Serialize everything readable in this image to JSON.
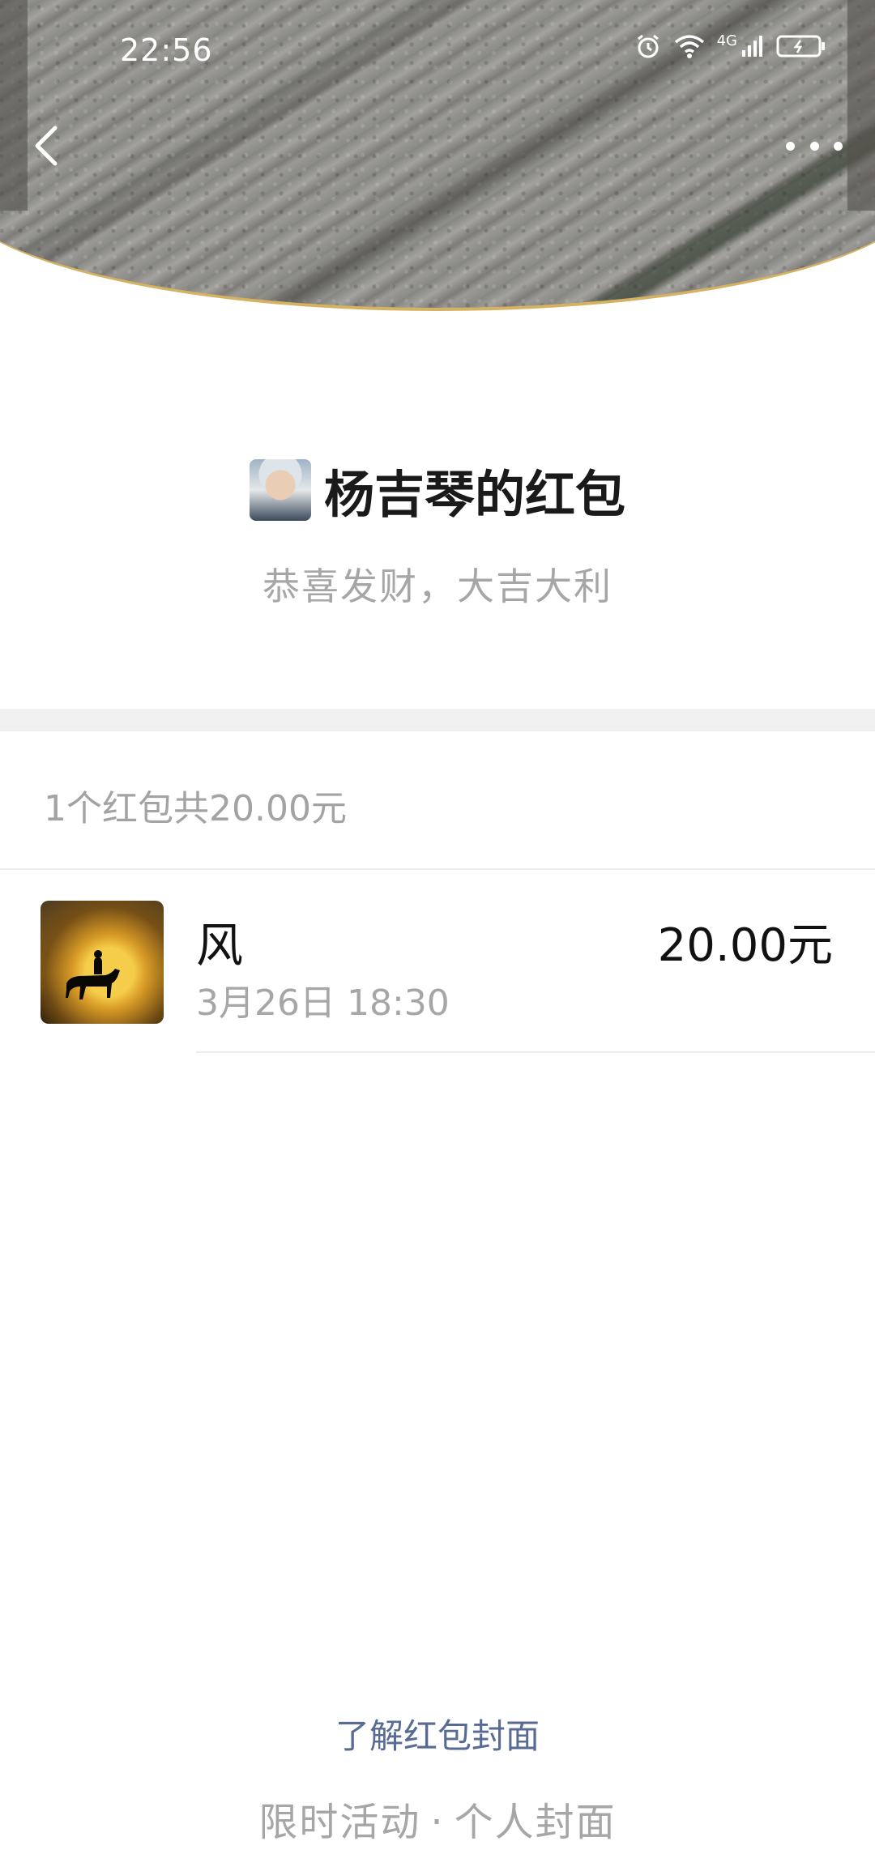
{
  "status_bar": {
    "time": "22:56",
    "network": "4G"
  },
  "nav": {
    "back_icon": "chevron-left-icon",
    "more_icon": "more-dots-icon"
  },
  "sender": {
    "title": "杨吉琴的红包",
    "wish": "恭喜发财，大吉大利"
  },
  "summary": {
    "text": "1个红包共20.00元"
  },
  "receivers": [
    {
      "name": "风",
      "time": "3月26日  18:30",
      "amount": "20.00元"
    }
  ],
  "footer": {
    "link": "了解红包封面",
    "sub_left": "限时活动",
    "sub_sep": "·",
    "sub_right": "个人封面"
  },
  "colors": {
    "link": "#576b95",
    "muted": "#a6a6a6",
    "gold_border": "#d4b261"
  }
}
